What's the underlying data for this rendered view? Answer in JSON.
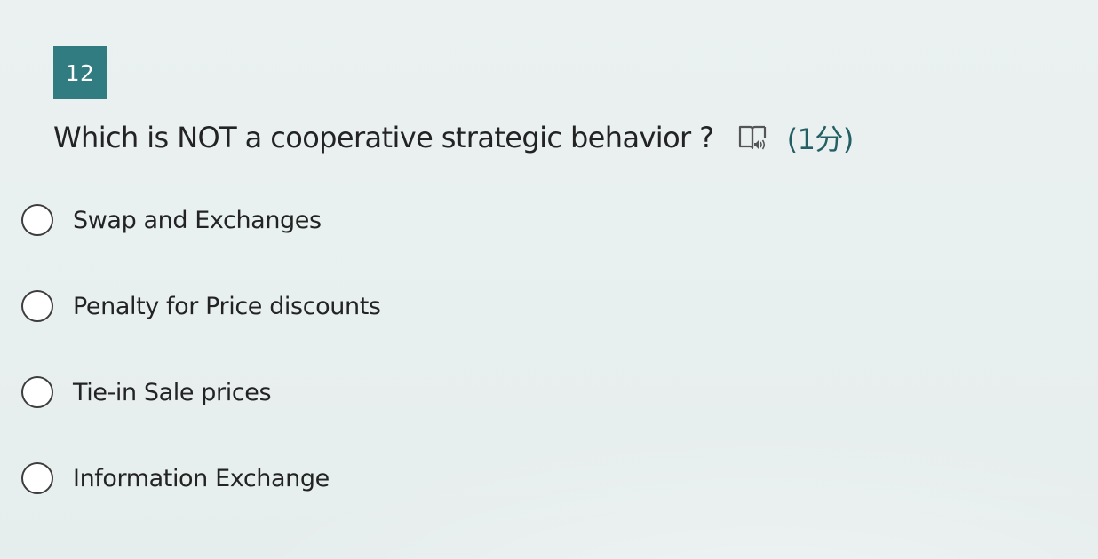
{
  "question": {
    "number": "12",
    "text": "Which is NOT a cooperative strategic behavior ?",
    "score": "(1分)",
    "read_aloud_icon": "book-speaker-icon"
  },
  "options": [
    {
      "label": "Swap and Exchanges",
      "selected": false
    },
    {
      "label": "Penalty for Price discounts",
      "selected": false
    },
    {
      "label": "Tie-in Sale prices",
      "selected": false
    },
    {
      "label": "Information Exchange",
      "selected": false
    }
  ],
  "colors": {
    "accent": "#317c80",
    "score_text": "#245f63",
    "background": "#e9f0f0",
    "text": "#232323"
  }
}
